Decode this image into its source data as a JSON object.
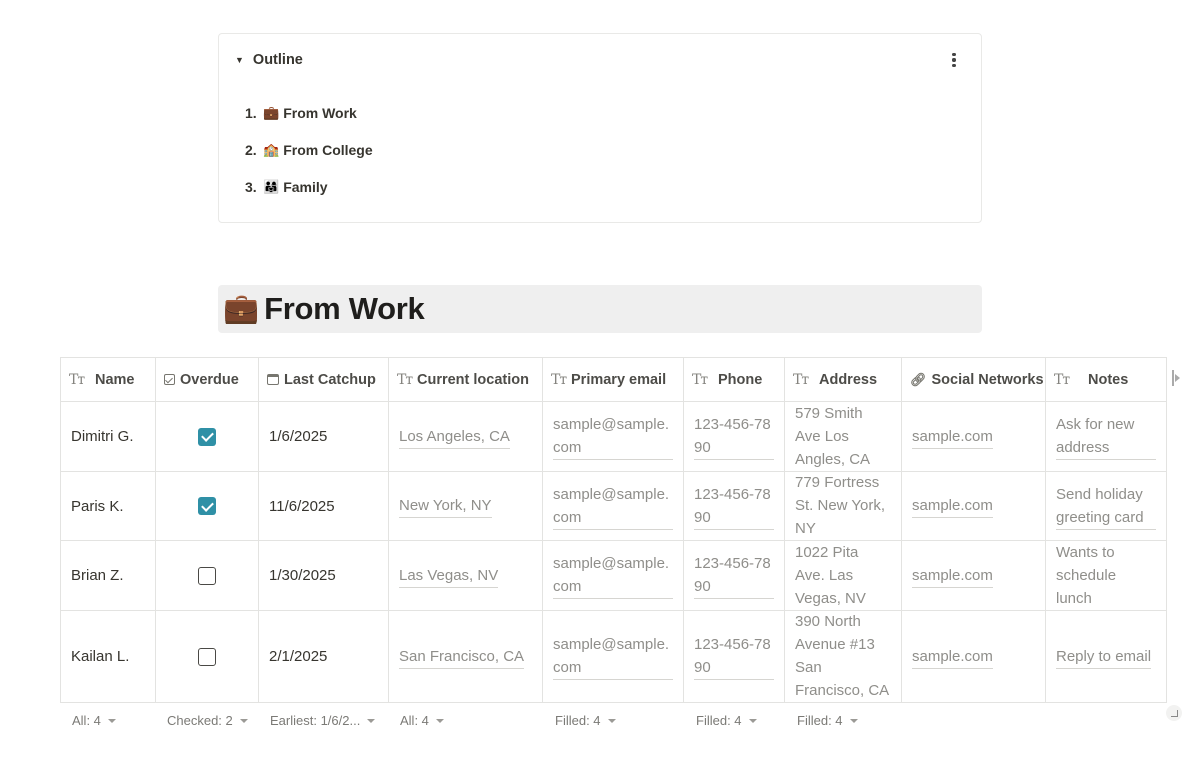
{
  "outline": {
    "title": "Outline",
    "items": [
      {
        "num": "1.",
        "emoji": "💼",
        "label": "From Work"
      },
      {
        "num": "2.",
        "emoji": "🏫",
        "label": "From College"
      },
      {
        "num": "3.",
        "emoji": "👨‍👩‍👧",
        "label": "Family"
      }
    ]
  },
  "section": {
    "emoji": "💼",
    "title": "From Work"
  },
  "table": {
    "columns": [
      "Name",
      "Overdue",
      "Last Catchup",
      "Current location",
      "Primary email",
      "Phone",
      "Address",
      "Social Networks",
      "Notes"
    ],
    "rows": [
      {
        "name": "Dimitri G.",
        "overdue": true,
        "last_catchup": "1/6/2025",
        "location": "Los Angeles, CA",
        "email": "sample@sample.com",
        "phone": "123-456-7890",
        "address": "579 Smith Ave Los Angles, CA",
        "social": "sample.com",
        "notes": "Ask for new address"
      },
      {
        "name": "Paris K.",
        "overdue": true,
        "last_catchup": "11/6/2025",
        "location": "New York, NY",
        "email": "sample@sample.com",
        "phone": "123-456-7890",
        "address": "779 Fortress St. New York, NY",
        "social": "sample.com",
        "notes": "Send holiday greeting card"
      },
      {
        "name": "Brian Z.",
        "overdue": false,
        "last_catchup": "1/30/2025",
        "location": "Las Vegas, NV",
        "email": "sample@sample.com",
        "phone": "123-456-7890",
        "address": "1022 Pita Ave. Las Vegas, NV",
        "social": "sample.com",
        "notes": "Wants to schedule lunch"
      },
      {
        "name": "Kailan L.",
        "overdue": false,
        "last_catchup": "2/1/2025",
        "location": "San Francisco, CA",
        "email": "sample@sample.com",
        "phone": "123-456-7890",
        "address": "390 North Avenue #13 San Francisco, CA",
        "social": "sample.com",
        "notes": "Reply to email"
      }
    ],
    "calculations": {
      "name": "All: 4",
      "overdue": "Checked: 2",
      "last_catchup": "Earliest: 1/6/2...",
      "location": "All: 4",
      "email": "Filled: 4",
      "phone": "Filled: 4",
      "address": "Filled: 4"
    }
  },
  "colors": {
    "checkbox_checked": "#2f90a6",
    "heading_bg": "#efefef"
  }
}
